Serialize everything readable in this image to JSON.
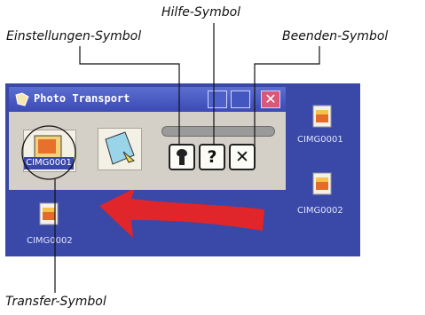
{
  "callouts": {
    "help": "Hilfe-Symbol",
    "settings": "Einstellungen-Symbol",
    "exit": "Beenden-Symbol",
    "transfer": "Transfer-Symbol"
  },
  "window": {
    "title": "Photo Transport",
    "transfer_file_label": "CIMG0001",
    "close_glyph": "✕"
  },
  "toolbar": {
    "settings_glyph": "🔧",
    "help_glyph": "?",
    "exit_glyph": "✕"
  },
  "desktop": {
    "files": [
      {
        "label": "CIMG0001"
      },
      {
        "label": "CIMG0002"
      },
      {
        "label": "CIMG0002"
      }
    ]
  },
  "colors": {
    "desktop": "#3a48a8",
    "titlebar": "#3c4ab5",
    "arrow": "#e0262a"
  }
}
